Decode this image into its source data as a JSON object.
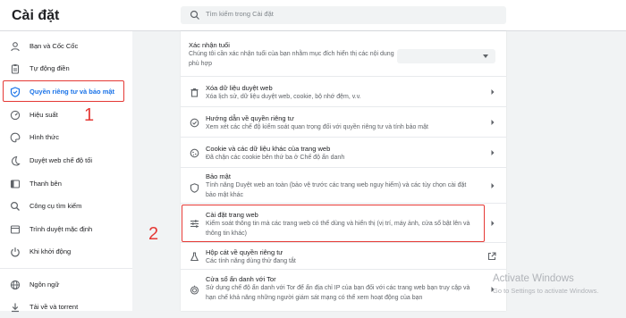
{
  "app": {
    "title": "Cài đặt"
  },
  "search": {
    "placeholder": "Tìm kiếm trong Cài đặt"
  },
  "sidebar": {
    "items": [
      {
        "label": "Bạn và Cốc Cốc",
        "icon": "person-icon",
        "active": false
      },
      {
        "label": "Tự động điền",
        "icon": "clipboard-icon",
        "active": false
      },
      {
        "label": "Quyền riêng tư và bảo mật",
        "icon": "shield-icon",
        "active": true
      },
      {
        "label": "Hiệu suất",
        "icon": "speedometer-icon",
        "active": false
      },
      {
        "label": "Hình thức",
        "icon": "palette-icon",
        "active": false
      },
      {
        "label": "Duyệt web chế độ tối",
        "icon": "moon-icon",
        "active": false
      },
      {
        "label": "Thanh bên",
        "icon": "sidebar-icon",
        "active": false
      },
      {
        "label": "Công cụ tìm kiếm",
        "icon": "search-icon",
        "active": false
      },
      {
        "label": "Trình duyệt mặc định",
        "icon": "browser-icon",
        "active": false
      },
      {
        "label": "Khi khởi động",
        "icon": "power-icon",
        "active": false
      },
      {
        "label": "Ngôn ngữ",
        "icon": "globe-icon",
        "active": false
      },
      {
        "label": "Tải về và torrent",
        "icon": "download-icon",
        "active": false
      }
    ]
  },
  "annotations": {
    "one": "1",
    "two": "2"
  },
  "main": {
    "age": {
      "title": "Xác nhận tuổi",
      "desc": "Chúng tôi cần xác nhận tuổi của bạn nhằm mục đích hiển thị các nội dung phù hợp",
      "dropdown_value": ""
    },
    "rows": [
      {
        "title": "Xóa dữ liệu duyệt web",
        "desc": "Xóa lịch sử, dữ liệu duyệt web, cookie, bộ nhớ đệm, v.v.",
        "icon": "trash-icon"
      },
      {
        "title": "Hướng dẫn về quyền riêng tư",
        "desc": "Xem xét các chế độ kiểm soát quan trọng đối với quyền riêng tư và tính bảo mật",
        "icon": "privacy-guide-icon"
      },
      {
        "title": "Cookie và các dữ liệu khác của trang web",
        "desc": "Đã chặn các cookie bên thứ ba ở Chế độ ẩn danh",
        "icon": "cookie-icon"
      },
      {
        "title": "Bảo mật",
        "desc": "Tính năng Duyệt web an toàn (bảo vệ trước các trang web nguy hiểm) và các tùy chọn cài đặt bảo mật khác",
        "icon": "security-shield-icon"
      },
      {
        "title": "Cài đặt trang web",
        "desc": "Kiểm soát thông tin mà các trang web có thể dùng và hiển thị (vị trí, máy ảnh, cửa sổ bật lên và thông tin khác)",
        "icon": "sliders-icon"
      },
      {
        "title": "Hộp cát về quyền riêng tư",
        "desc": "Các tính năng dùng thử đang tắt",
        "icon": "flask-icon"
      },
      {
        "title": "Cửa sổ ẩn danh với Tor",
        "desc": "Sử dụng chế độ ẩn danh với Tor để ẩn địa chỉ IP của bạn đối với các trang web bạn truy cập và hạn chế khả năng những người giám sát mạng có thể xem hoạt động của bạn",
        "icon": "tor-icon"
      }
    ]
  },
  "watermark": {
    "line1": "Activate Windows",
    "line2": "Go to Settings to activate Windows."
  },
  "colors": {
    "accent": "#1a73e8",
    "annotation": "#e53935"
  }
}
